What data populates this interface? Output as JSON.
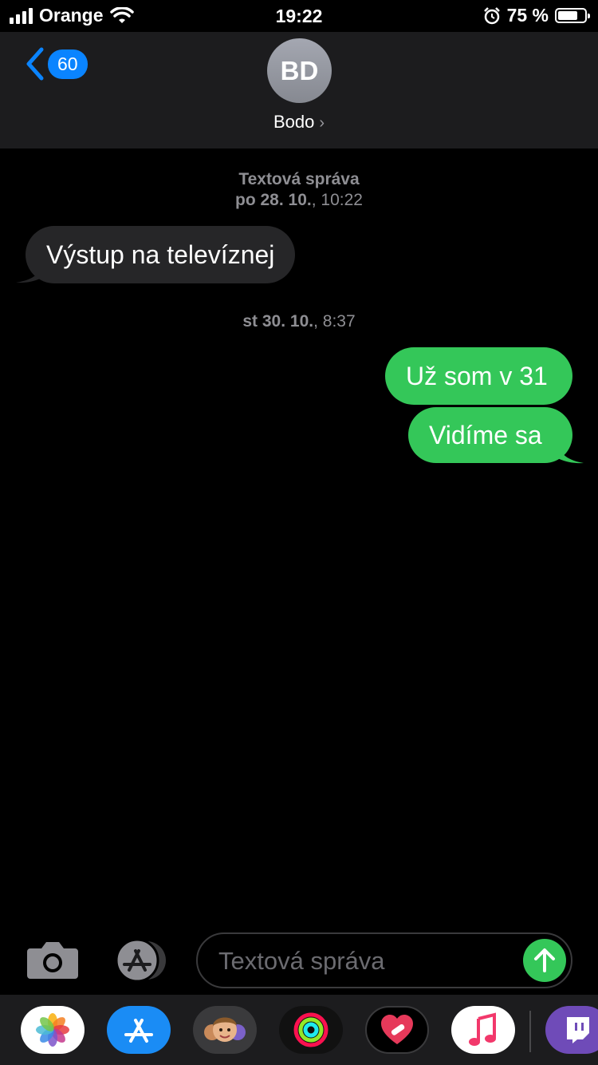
{
  "status_bar": {
    "carrier": "Orange",
    "time": "19:22",
    "battery_percent": "75 %",
    "battery_level": 0.75
  },
  "header": {
    "back_count": "60",
    "avatar_initials": "BD",
    "contact_name": "Bodo"
  },
  "thread": {
    "service_label": "Textová správa",
    "groups": [
      {
        "date": "po 28. 10.",
        "time": ", 10:22"
      },
      {
        "date": "st 30. 10.",
        "time": ", 8:37"
      }
    ],
    "messages": [
      {
        "direction": "incoming",
        "text": "Výstup na televíznej"
      },
      {
        "direction": "outgoing",
        "text": "Už som v 31"
      },
      {
        "direction": "outgoing",
        "text": "Vidíme sa"
      }
    ]
  },
  "composer": {
    "placeholder": "Textová správa"
  },
  "app_drawer": [
    "photos-icon",
    "app-store-icon",
    "memoji-icon",
    "activity-icon",
    "heart-app-icon",
    "music-icon",
    "twitch-icon"
  ],
  "colors": {
    "imessage_green": "#34c759",
    "incoming_bubble": "#262628",
    "accent_blue": "#0a84ff",
    "background": "#000000"
  }
}
